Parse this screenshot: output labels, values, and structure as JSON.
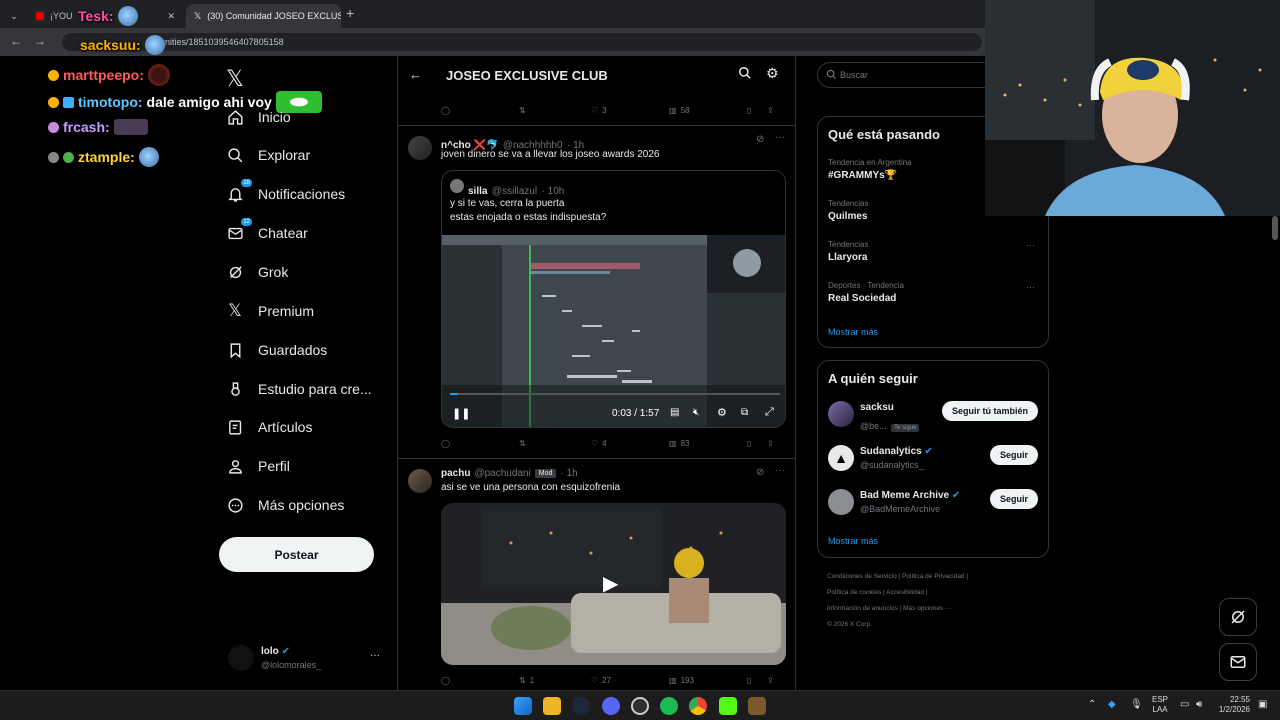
{
  "browser": {
    "tabs": [
      {
        "label": "¡YOU"
      },
      {
        "label": "(30) Comunidad JOSEO EXCLUS"
      }
    ],
    "new_tab": "+",
    "url": "unities/1851039546407805158"
  },
  "chat_overlay": [
    {
      "user": "Tesk:"
    },
    {
      "user": "sacksuu:"
    },
    {
      "user": "marttpeepo:"
    },
    {
      "user": "timotopo:",
      "message": "dale amigo ahi voy"
    },
    {
      "user": "frcash:"
    },
    {
      "user": "ztample:"
    }
  ],
  "nav": {
    "items": [
      {
        "label": "Inicio"
      },
      {
        "label": "Explorar"
      },
      {
        "label": "Notificaciones",
        "badge": "18"
      },
      {
        "label": "Chatear",
        "badge": "12"
      },
      {
        "label": "Grok"
      },
      {
        "label": "Premium"
      },
      {
        "label": "Guardados"
      },
      {
        "label": "Estudio para cre..."
      },
      {
        "label": "Artículos"
      },
      {
        "label": "Perfil"
      },
      {
        "label": "Más opciones"
      }
    ],
    "post_button": "Postear",
    "account": {
      "name": "lolo",
      "handle": "@lolomorales_",
      "more": "···"
    }
  },
  "feed": {
    "header_title": "JOSEO EXCLUSIVE CLUB",
    "top_actions": {
      "likes": "3",
      "views": "58"
    },
    "tweets": [
      {
        "name": "n^cho ❌🐬",
        "handle": "@nachhhhh0",
        "time": "· 1h",
        "text": "joven dinero se va a llevar los joseo awards 2026",
        "quote": {
          "name": "silla",
          "handle": "@ssillazul",
          "time": "· 10h",
          "text_line1": "y si te vas, cerra la puerta",
          "text_line2": "estas enojada o estas indispuesta?"
        },
        "video_time": "0:03 / 1:57",
        "likes": "4",
        "views": "83"
      },
      {
        "name": "pachu",
        "handle": "@pachudani",
        "mod_badge": "Mod",
        "time": "· 1h",
        "text": "asi se ve una persona con esquizofrenia",
        "retweets": "1",
        "likes": "27",
        "views": "193"
      }
    ]
  },
  "sidebar": {
    "search_placeholder": "Buscar",
    "trends_title": "Qué está pasando",
    "trends": [
      {
        "meta": "Tendencia en Argentina",
        "title": "#GRAMMYs🏆"
      },
      {
        "meta": "Tendencias",
        "title": "Quilmes"
      },
      {
        "meta": "Tendencias",
        "title": "Llaryora"
      },
      {
        "meta": "Deportes · Tendencia",
        "title": "Real Sociedad"
      }
    ],
    "trends_more": "Mostrar más",
    "follow_title": "A quién seguir",
    "follow": [
      {
        "name": "sacksu",
        "handle": "@be...",
        "follows_you": "Te sigue",
        "button": "Seguir tú también"
      },
      {
        "name": "Sudanalytics",
        "handle": "@sudanalytics_",
        "button": "Seguir"
      },
      {
        "name": "Bad Meme Archive",
        "handle": "@BadMemeArchive",
        "button": "Seguir"
      }
    ],
    "follow_more": "Mostrar más",
    "footer": {
      "line1_a": "Condiciones de Servicio",
      "line1_b": "Política de Privacidad",
      "line2_a": "Política de cookies",
      "line2_b": "Accesibilidad",
      "line3_a": "Información de anuncios",
      "line3_b": "Más opciones ···",
      "line4": "© 2026 X Corp."
    }
  },
  "taskbar": {
    "lang": "ESP",
    "lang2": "LAA",
    "time": "22:55",
    "date": "1/2/2026"
  },
  "colors": {
    "accent": "#1d9bf0",
    "background": "#000000",
    "border": "#2f3336",
    "muted": "#71767b"
  }
}
